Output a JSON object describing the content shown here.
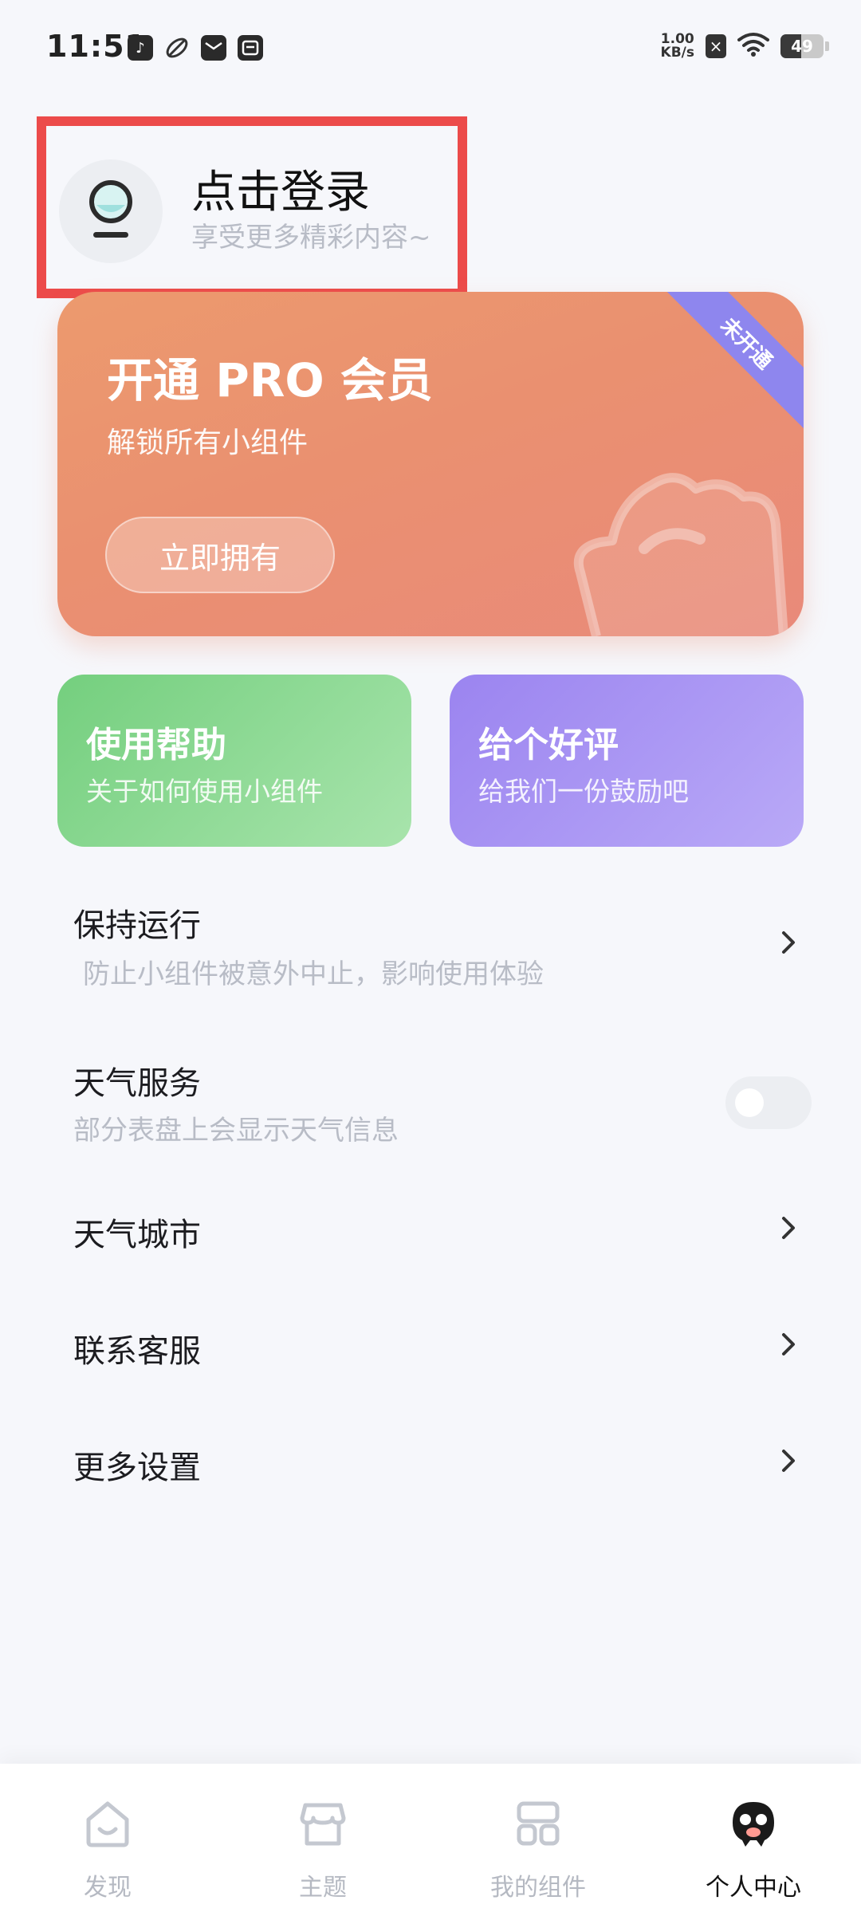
{
  "status_bar": {
    "time": "11:51",
    "net_speed_value": "1.00",
    "net_speed_unit": "KB/s",
    "battery_level": "49",
    "icons": [
      "tiktok-icon",
      "leaf-icon",
      "mail-icon",
      "inbox-icon",
      "sim-x-icon",
      "wifi-icon",
      "battery-icon"
    ]
  },
  "login": {
    "title": "点击登录",
    "subtitle": "享受更多精彩内容~",
    "highlight_color": "#ec4b4a"
  },
  "pro_card": {
    "title": "开通 PRO 会员",
    "subtitle": "解锁所有小组件",
    "button_label": "立即拥有",
    "ribbon": "未开通",
    "accent": "#ea9070",
    "ribbon_color": "#8e86ee"
  },
  "features": [
    {
      "title": "使用帮助",
      "subtitle": "关于如何使用小组件",
      "color": "#74cf7e"
    },
    {
      "title": "给个好评",
      "subtitle": "给我们一份鼓励吧",
      "color": "#9b84f0"
    }
  ],
  "settings": [
    {
      "title": "保持运行",
      "subtitle": "防止小组件被意外中止，影响使用体验",
      "control": "chevron"
    },
    {
      "title": "天气服务",
      "subtitle": "部分表盘上会显示天气信息",
      "control": "toggle",
      "enabled": false
    },
    {
      "title": "天气城市",
      "control": "chevron"
    },
    {
      "title": "联系客服",
      "control": "chevron"
    },
    {
      "title": "更多设置",
      "control": "chevron"
    }
  ],
  "bottom_nav": [
    {
      "label": "发现",
      "icon": "home-smile-icon",
      "active": false
    },
    {
      "label": "主题",
      "icon": "store-icon",
      "active": false
    },
    {
      "label": "我的组件",
      "icon": "widgets-grid-icon",
      "active": false
    },
    {
      "label": "个人中心",
      "icon": "profile-mascot-icon",
      "active": true
    }
  ]
}
